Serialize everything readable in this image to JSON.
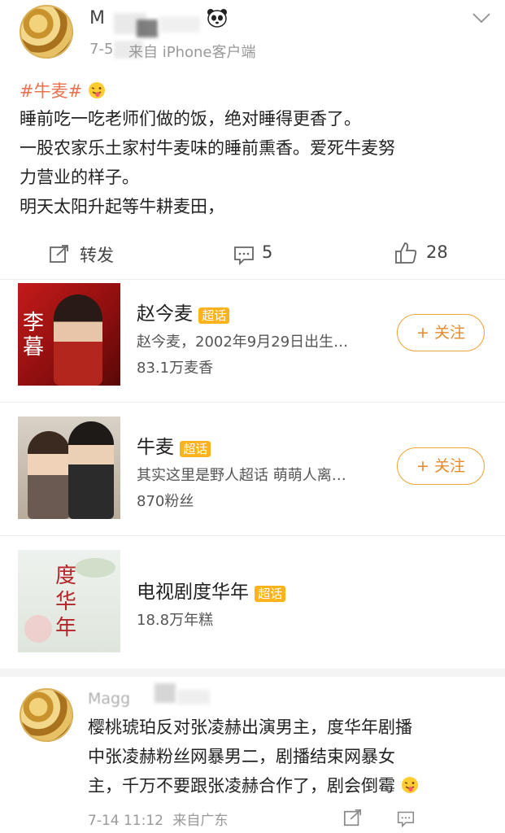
{
  "post": {
    "author": "M",
    "date": "7-5",
    "source": "来自 iPhone客户端",
    "topic": "#牛麦#",
    "lines": [
      "睡前吃一吃老师们做的饭，绝对睡得更香了。",
      "一股农家乐土家村牛麦味的睡前熏香。爱死牛麦努",
      "力营业的样子。",
      "明天太阳升起等牛耕麦田，"
    ],
    "actions": {
      "repost_label": "转发",
      "comment_count": "5",
      "like_count": "28"
    }
  },
  "cards": [
    {
      "title": "赵今麦",
      "badge": "超话",
      "desc": "赵今麦，2002年9月29日出生…",
      "stat": "83.1万麦香",
      "button": "+ 关注",
      "thumb_text": "李暮"
    },
    {
      "title": "牛麦",
      "badge": "超话",
      "desc": "其实这里是野人超话 萌萌人离…",
      "stat": "870粉丝",
      "button": "+ 关注"
    },
    {
      "title": "电视剧度华年",
      "badge": "超话",
      "stat": "18.8万年糕",
      "thumb_text": "度华年"
    }
  ],
  "comment": {
    "author": "Magg",
    "lines": [
      "樱桃琥珀反对张凌赫出演男主，度华年剧播",
      "中张凌赫粉丝网暴男二，剧播结束网暴女",
      "主，千万不要跟张凌赫合作了，剧会倒霉"
    ],
    "date": "7-14 11:12",
    "source": "来自广东"
  },
  "colors": {
    "link": "#eb7350",
    "orange_button": "#e6892a",
    "badge": "#ffb31a"
  }
}
